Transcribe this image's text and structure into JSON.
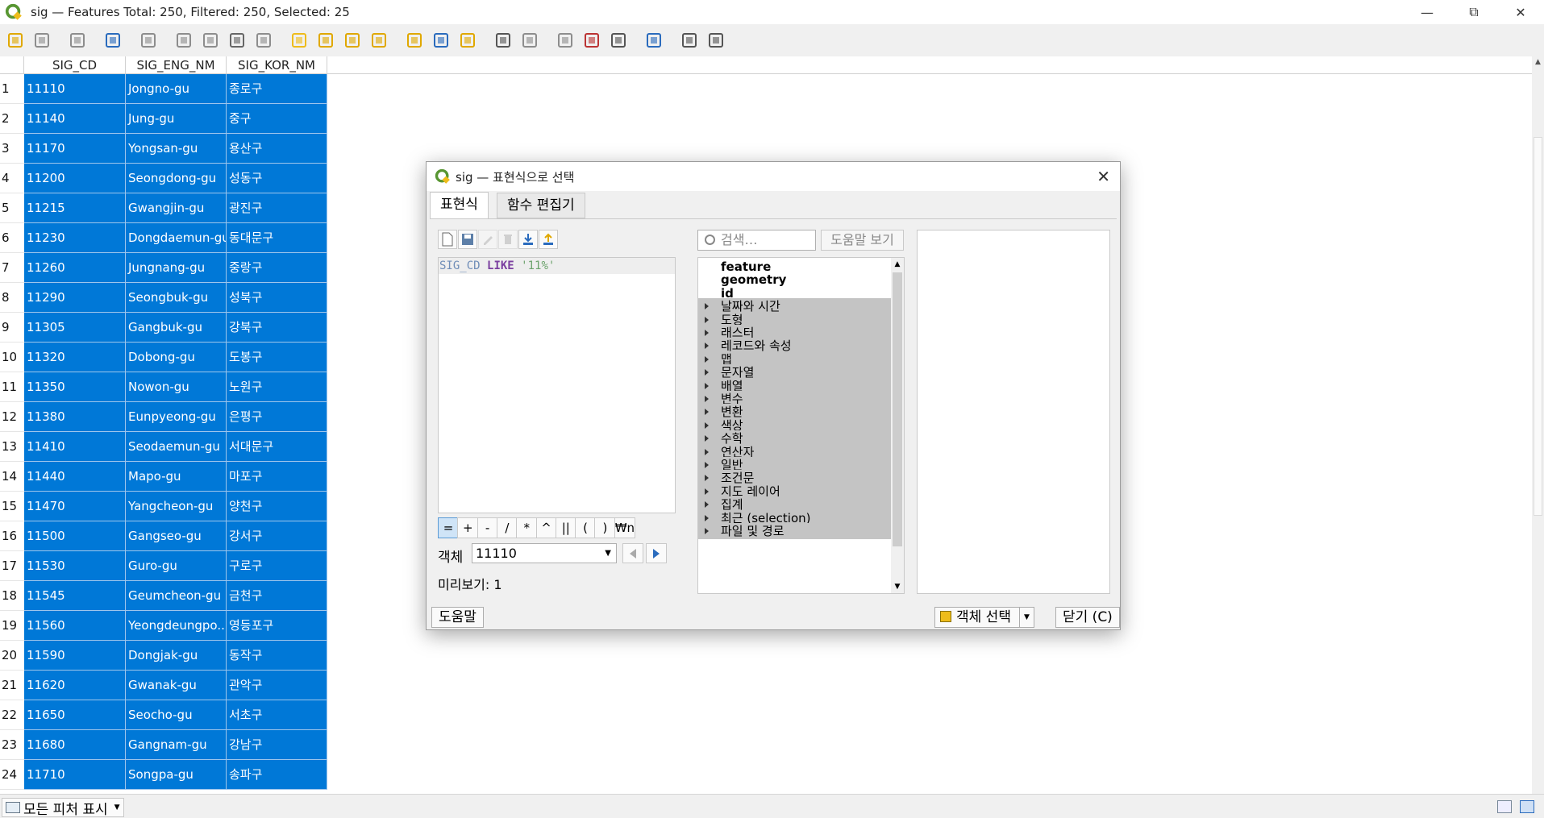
{
  "window": {
    "title": "sig — Features Total: 250, Filtered: 250, Selected: 25"
  },
  "colors": {
    "selected_row": "#0078d7",
    "qgis_green": "#589632",
    "qgis_yellow": "#eebc1b"
  },
  "toolbar_icons": [
    "toggle-edit-icon",
    "multi-edit-icon",
    "save-edits-icon",
    "reload-icon",
    "add-feature-icon",
    "delete-feature-icon",
    "cut-icon",
    "copy-icon",
    "paste-icon",
    "select-by-expression-icon",
    "select-all-icon",
    "invert-selection-icon",
    "deselect-icon",
    "filter-icon",
    "move-selection-top-icon",
    "pan-to-selection-icon",
    "zoom-to-selection-icon",
    "new-field-icon",
    "delete-field-icon",
    "field-calculator-icon",
    "conditional-formatting-icon",
    "dock-table-icon",
    "actions-icon",
    "form-view-icon"
  ],
  "table": {
    "headers": [
      "SIG_CD",
      "SIG_ENG_NM",
      "SIG_KOR_NM"
    ],
    "rows": [
      {
        "n": "1",
        "cd": "11110",
        "eng": "Jongno-gu",
        "kor": "종로구"
      },
      {
        "n": "2",
        "cd": "11140",
        "eng": "Jung-gu",
        "kor": "중구"
      },
      {
        "n": "3",
        "cd": "11170",
        "eng": "Yongsan-gu",
        "kor": "용산구"
      },
      {
        "n": "4",
        "cd": "11200",
        "eng": "Seongdong-gu",
        "kor": "성동구"
      },
      {
        "n": "5",
        "cd": "11215",
        "eng": "Gwangjin-gu",
        "kor": "광진구"
      },
      {
        "n": "6",
        "cd": "11230",
        "eng": "Dongdaemun-gu",
        "kor": "동대문구"
      },
      {
        "n": "7",
        "cd": "11260",
        "eng": "Jungnang-gu",
        "kor": "중랑구"
      },
      {
        "n": "8",
        "cd": "11290",
        "eng": "Seongbuk-gu",
        "kor": "성북구"
      },
      {
        "n": "9",
        "cd": "11305",
        "eng": "Gangbuk-gu",
        "kor": "강북구"
      },
      {
        "n": "10",
        "cd": "11320",
        "eng": "Dobong-gu",
        "kor": "도봉구"
      },
      {
        "n": "11",
        "cd": "11350",
        "eng": "Nowon-gu",
        "kor": "노원구"
      },
      {
        "n": "12",
        "cd": "11380",
        "eng": "Eunpyeong-gu",
        "kor": "은평구"
      },
      {
        "n": "13",
        "cd": "11410",
        "eng": "Seodaemun-gu",
        "kor": "서대문구"
      },
      {
        "n": "14",
        "cd": "11440",
        "eng": "Mapo-gu",
        "kor": "마포구"
      },
      {
        "n": "15",
        "cd": "11470",
        "eng": "Yangcheon-gu",
        "kor": "양천구"
      },
      {
        "n": "16",
        "cd": "11500",
        "eng": "Gangseo-gu",
        "kor": "강서구"
      },
      {
        "n": "17",
        "cd": "11530",
        "eng": "Guro-gu",
        "kor": "구로구"
      },
      {
        "n": "18",
        "cd": "11545",
        "eng": "Geumcheon-gu",
        "kor": "금천구"
      },
      {
        "n": "19",
        "cd": "11560",
        "eng": "Yeongdeungpo...",
        "kor": "영등포구"
      },
      {
        "n": "20",
        "cd": "11590",
        "eng": "Dongjak-gu",
        "kor": "동작구"
      },
      {
        "n": "21",
        "cd": "11620",
        "eng": "Gwanak-gu",
        "kor": "관악구"
      },
      {
        "n": "22",
        "cd": "11650",
        "eng": "Seocho-gu",
        "kor": "서초구"
      },
      {
        "n": "23",
        "cd": "11680",
        "eng": "Gangnam-gu",
        "kor": "강남구"
      },
      {
        "n": "24",
        "cd": "11710",
        "eng": "Songpa-gu",
        "kor": "송파구"
      }
    ]
  },
  "statusbar": {
    "show_all_label": "모든 피처 표시"
  },
  "dialog": {
    "title": "sig — 표현식으로 선택",
    "tabs": [
      "표현식",
      "함수 편집기"
    ],
    "expression": {
      "field": "SIG_CD",
      "operator": "LIKE",
      "literal": "'11%'"
    },
    "operators": [
      "=",
      "+",
      "-",
      "/",
      "*",
      "^",
      "||",
      "(",
      ")",
      "₩n"
    ],
    "feature_label": "객체",
    "feature_value": "11110",
    "preview": "미리보기:  1",
    "search_placeholder": "검색…",
    "help_view": "도움말 보기",
    "tree_items": [
      {
        "label": "feature",
        "bold": true,
        "group": false
      },
      {
        "label": "geometry",
        "bold": true,
        "group": false
      },
      {
        "label": "id",
        "bold": true,
        "group": false
      },
      {
        "label": "날짜와 시간",
        "bold": false,
        "group": true
      },
      {
        "label": "도형",
        "bold": false,
        "group": true
      },
      {
        "label": "래스터",
        "bold": false,
        "group": true
      },
      {
        "label": "레코드와 속성",
        "bold": false,
        "group": true
      },
      {
        "label": "맵",
        "bold": false,
        "group": true
      },
      {
        "label": "문자열",
        "bold": false,
        "group": true
      },
      {
        "label": "배열",
        "bold": false,
        "group": true
      },
      {
        "label": "변수",
        "bold": false,
        "group": true
      },
      {
        "label": "변환",
        "bold": false,
        "group": true
      },
      {
        "label": "색상",
        "bold": false,
        "group": true
      },
      {
        "label": "수학",
        "bold": false,
        "group": true
      },
      {
        "label": "연산자",
        "bold": false,
        "group": true
      },
      {
        "label": "일반",
        "bold": false,
        "group": true
      },
      {
        "label": "조건문",
        "bold": false,
        "group": true
      },
      {
        "label": "지도 레이어",
        "bold": false,
        "group": true
      },
      {
        "label": "집계",
        "bold": false,
        "group": true
      },
      {
        "label": "최근 (selection)",
        "bold": false,
        "group": true
      },
      {
        "label": "파일 및 경로",
        "bold": false,
        "group": true
      }
    ],
    "help_button": "도움말",
    "select_features_button": "객체 선택",
    "close_button": "닫기 (C)"
  }
}
